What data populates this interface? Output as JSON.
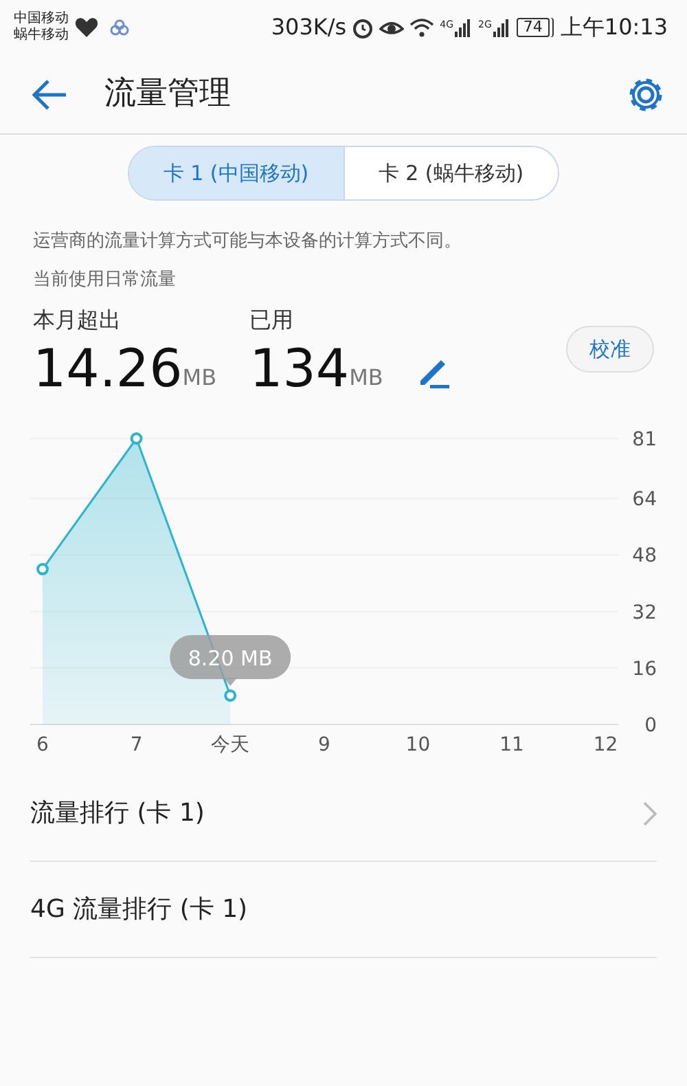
{
  "status_bar": {
    "carriers": [
      "中国移动",
      "蜗牛移动"
    ],
    "speed": "303K/s",
    "signals": [
      "4G",
      "2G"
    ],
    "battery": "74",
    "time": "上午10:13"
  },
  "header": {
    "title": "流量管理"
  },
  "sim_tabs": [
    {
      "label": "卡 1 (中国移动)",
      "selected": true
    },
    {
      "label": "卡 2 (蜗牛移动)",
      "selected": false
    }
  ],
  "notice": "运营商的流量计算方式可能与本设备的计算方式不同。",
  "subtitle": "当前使用日常流量",
  "stats": [
    {
      "label": "本月超出",
      "value": "14.26",
      "unit": "MB"
    },
    {
      "label": "已用",
      "value": "134",
      "unit": "MB"
    }
  ],
  "calibrate_button": "校准",
  "usage_chart": {
    "chart_data": {
      "type": "area",
      "categories": [
        "6",
        "7",
        "今天",
        "9",
        "10",
        "11",
        "12"
      ],
      "series": [
        {
          "color": "#2bb5cf",
          "values": [
            44,
            81,
            8.2,
            null,
            null,
            null,
            null
          ]
        }
      ],
      "ylim": [
        0,
        81
      ],
      "yticks": [
        0,
        16,
        32,
        48,
        64,
        81
      ],
      "grid": true,
      "annotations": [
        "8.20 MB"
      ]
    }
  },
  "menu": [
    {
      "label": "流量排行 (卡 1)",
      "chevron": true
    },
    {
      "label": "4G 流量排行 (卡 1)",
      "chevron": false
    }
  ]
}
